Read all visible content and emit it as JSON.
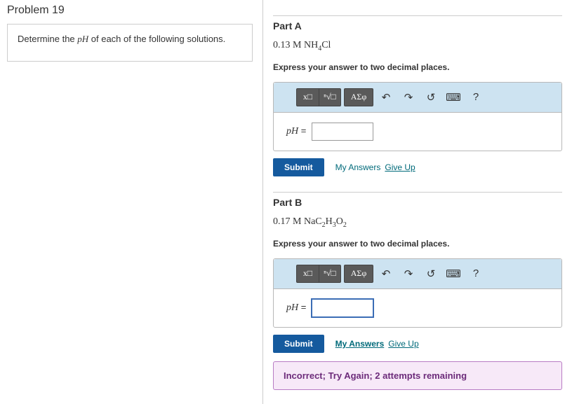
{
  "problem": {
    "title": "Problem 19",
    "prompt_pre": "Determine the ",
    "prompt_var": "pH",
    "prompt_post": " of each of the following solutions."
  },
  "partA": {
    "title": "Part A",
    "conc": "0.13 ",
    "unit": "M",
    "formula_html": " NH<sub>4</sub>Cl",
    "instruction": "Express your answer to two decimal places.",
    "input_label": "pH",
    "equals": " = ",
    "input_value": "",
    "submit": "Submit",
    "my_answers": "My Answers",
    "give_up": "Give Up"
  },
  "partB": {
    "title": "Part B",
    "conc": "0.17 ",
    "unit": "M",
    "formula_html": " NaC<sub>2</sub>H<sub>3</sub>O<sub>2</sub>",
    "instruction": "Express your answer to two decimal places.",
    "input_label": "pH",
    "equals": " = ",
    "input_value": "",
    "submit": "Submit",
    "my_answers": "My Answers",
    "give_up": "Give Up",
    "feedback": "Incorrect; Try Again; 2 attempts remaining"
  },
  "toolbar": {
    "template": "x□",
    "root": "ⁿ√□",
    "greek": "ΑΣφ",
    "undo": "↶",
    "redo": "↷",
    "reset": "↺",
    "keyboard": "⌨",
    "help": "?"
  }
}
